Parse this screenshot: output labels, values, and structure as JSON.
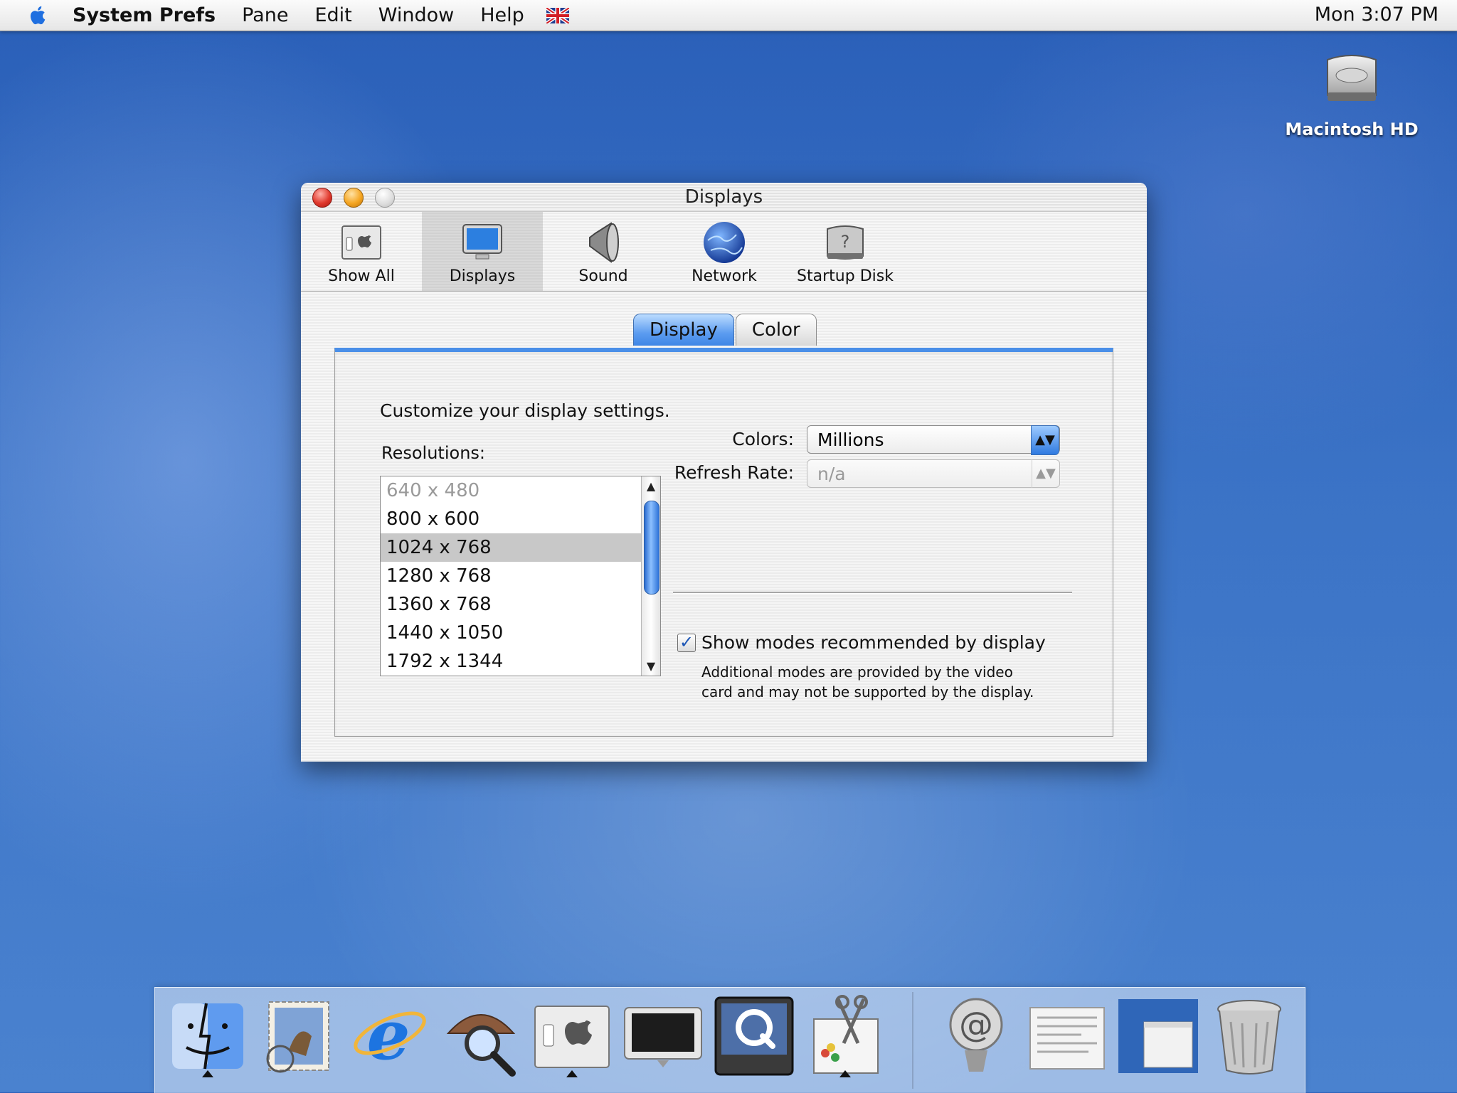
{
  "menubar": {
    "app_name": "System Prefs",
    "items": [
      "Pane",
      "Edit",
      "Window",
      "Help"
    ],
    "clock": "Mon 3:07 PM"
  },
  "desktop": {
    "hd_label": "Macintosh HD"
  },
  "window": {
    "title": "Displays",
    "toolbar": [
      "Show All",
      "Displays",
      "Sound",
      "Network",
      "Startup Disk"
    ],
    "selected_tool": "Displays",
    "tabs": [
      "Display",
      "Color"
    ],
    "active_tab": "Display",
    "intro": "Customize your display settings.",
    "resolutions_label": "Resolutions:",
    "resolutions": [
      "640 x 480",
      "800 x 600",
      "1024 x 768",
      "1280 x 768",
      "1360 x 768",
      "1440 x 1050",
      "1792 x 1344"
    ],
    "selected_resolution": "1024 x 768",
    "colors_label": "Colors:",
    "colors_value": "Millions",
    "refresh_label": "Refresh Rate:",
    "refresh_value": "n/a",
    "checkbox_label": "Show modes recommended by display",
    "checkbox_checked": true,
    "note_line1": "Additional modes are provided by the video",
    "note_line2": "card and may not be supported by the display."
  },
  "dock": {
    "items": [
      "finder-icon",
      "mail-icon",
      "internet-explorer-icon",
      "sherlock-icon",
      "system-preferences-icon",
      "display-icon",
      "quicktime-icon",
      "preview-icon",
      "mail-address-icon",
      "document-icon",
      "window-icon",
      "trash-icon"
    ]
  },
  "colors": {
    "accent": "#3f86e6",
    "close": "#e0392d",
    "minimize": "#f5a623"
  }
}
